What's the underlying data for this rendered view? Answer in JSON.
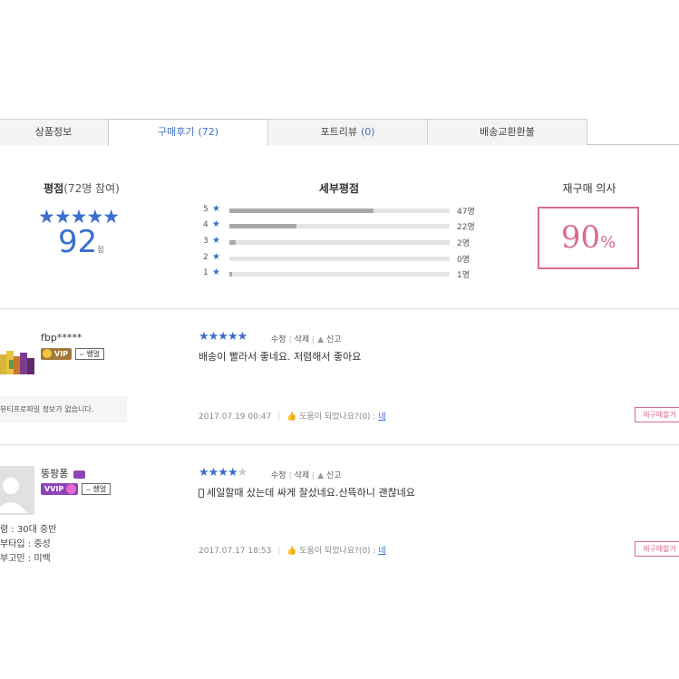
{
  "tabs": [
    {
      "label": "상품정보",
      "count": ""
    },
    {
      "label": "구매후기",
      "count": "(72)"
    },
    {
      "label": "포트리뷰",
      "count": "(0)"
    },
    {
      "label": "배송교환환불",
      "count": ""
    }
  ],
  "summary": {
    "rating_title": "평점",
    "rating_sub": "(72명 참여)",
    "stars": "★★★★★",
    "score": "92",
    "score_unit": "점",
    "detail_title": "세부평점",
    "rebuy_title": "재구매 의사",
    "rebuy_value": "90",
    "rebuy_unit": "%",
    "star_glyph": "★",
    "breakdown": [
      {
        "star": "5",
        "count_label": "47명",
        "ratio": 0.653
      },
      {
        "star": "4",
        "count_label": "22명",
        "ratio": 0.306
      },
      {
        "star": "3",
        "count_label": "2명",
        "ratio": 0.028
      },
      {
        "star": "2",
        "count_label": "0명",
        "ratio": 0.0
      },
      {
        "star": "1",
        "count_label": "1명",
        "ratio": 0.014
      }
    ]
  },
  "reviews": [
    {
      "user": "fbp*****",
      "grade": "VIP",
      "skin": "쌩얼",
      "stars_on": "★★★★★",
      "stars_off": "",
      "edit": "수정",
      "delete": "삭제",
      "report": "신고",
      "text": "배송이 빨라서 좋네요. 저렴해서 좋아요",
      "date": "2017.07.19 00:47",
      "helpful": "도움이 되었나요?(0) :",
      "yes": "네",
      "rebuy_tag": "재구매할거",
      "profile_note": "뷰티프로파일 정보가 없습니다."
    },
    {
      "user": "뚱팡퐁",
      "grade": "VVIP",
      "skin": "쌩얼",
      "stars_on": "★★★★",
      "stars_off": "★",
      "edit": "수정",
      "delete": "삭제",
      "report": "신고",
      "text": "세일할때 샀는데 싸게 잘샀네요.산뜩하니 괜찮네요",
      "date": "2017.07.17 18:53",
      "helpful": "도움이 되었나요?(0) :",
      "yes": "네",
      "rebuy_tag": "재구매할거",
      "attrs": [
        "령 : 30대 중반",
        "부타입 : 중성",
        "부고민 : 미백"
      ]
    }
  ],
  "colors": {
    "accent": "#3b6fce",
    "pink": "#d96b8e",
    "vip": "#a07a3a",
    "vvip": "#8e44b8"
  }
}
